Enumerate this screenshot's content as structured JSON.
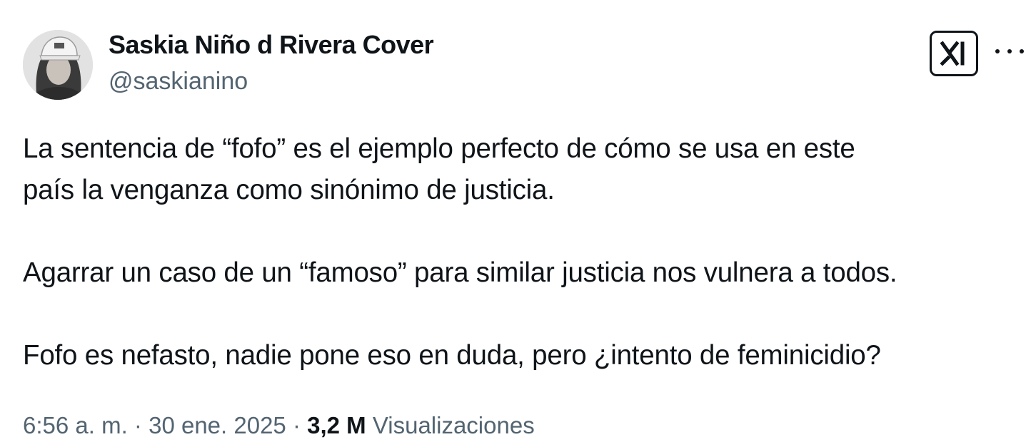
{
  "author": {
    "display_name": "Saskia Niño d Rivera Cover",
    "handle": "@saskianino"
  },
  "toolbar": {
    "grok_icon": "grok-icon",
    "more_icon": "more-horizontal-icon"
  },
  "post": {
    "paragraphs": [
      [
        "La sentencia de “fofo” es el ejemplo perfecto de cómo se usa en este",
        "país la venganza como sinónimo de justicia."
      ],
      [
        "Agarrar un caso de un “famoso” para similar justicia nos vulnera a todos."
      ],
      [
        "Fofo es nefasto, nadie pone eso en duda, pero ¿intento de feminicidio?"
      ]
    ]
  },
  "meta": {
    "time": "6:56 a. m.",
    "separator": "·",
    "date": "30 ene. 2025",
    "views_count": "3,2 M",
    "views_label": "Visualizaciones"
  },
  "colors": {
    "text": "#0f1419",
    "secondary": "#536471",
    "background": "#ffffff"
  }
}
